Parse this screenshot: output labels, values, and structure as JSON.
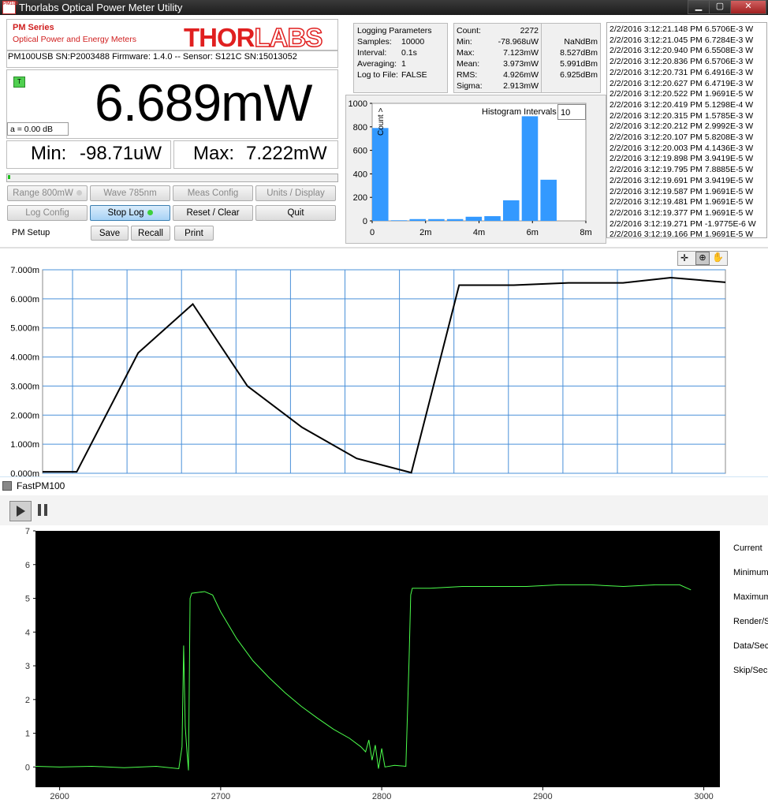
{
  "window": {
    "title": "Thorlabs Optical Power Meter Utility",
    "icon_text": "PM100",
    "controls": [
      "minimize",
      "maximize",
      "close"
    ]
  },
  "brand": {
    "series": "PM Series",
    "subtitle": "Optical Power and Energy Meters",
    "logo": "THORLABS"
  },
  "device": {
    "info": "PM100USB  SN:P2003488  Firmware: 1.4.0 -- Sensor: S121C  SN:15013052"
  },
  "reading": {
    "value": "6.689mW",
    "trigger_badge": "T",
    "attenuation": "a = 0.00  dB"
  },
  "minmax": {
    "min_label": "Min:",
    "min_value": "-98.71uW",
    "max_label": "Max:",
    "max_value": "7.222mW"
  },
  "buttons": {
    "range": "Range 800mW",
    "wave": "Wave 785nm",
    "meas_config": "Meas Config",
    "units_display": "Units / Display",
    "log_config": "Log Config",
    "stop_log": "Stop Log",
    "reset_clear": "Reset / Clear",
    "quit": "Quit",
    "pm_setup_label": "PM Setup",
    "save": "Save",
    "recall": "Recall",
    "print": "Print"
  },
  "logging": {
    "title": "Logging Parameters",
    "samples_label": "Samples:",
    "samples": "10000",
    "interval_label": "Interval:",
    "interval": "0.1s",
    "averaging_label": "Averaging:",
    "averaging": "1",
    "log_file_label": "Log to File:",
    "log_file": "FALSE"
  },
  "stats": {
    "count_label": "Count:",
    "count": "2272",
    "min_label": "Min:",
    "min": "-78.968uW",
    "min_dbm": "NaNdBm",
    "max_label": "Max:",
    "max": "7.123mW",
    "max_dbm": "8.527dBm",
    "mean_label": "Mean:",
    "mean": "3.973mW",
    "mean_dbm": "5.991dBm",
    "rms_label": "RMS:",
    "rms": "4.926mW",
    "rms_dbm": "6.925dBm",
    "sigma_label": "Sigma:",
    "sigma": "2.913mW"
  },
  "histogram": {
    "intervals_label": "Histogram Intervals",
    "intervals": "10",
    "count_axis_label": "Count >"
  },
  "log_lines": [
    "2/2/2016 3:12:21.148 PM 6.5706E-3 W",
    "2/2/2016 3:12:21.045 PM 6.7284E-3 W",
    "2/2/2016 3:12:20.940 PM 6.5508E-3 W",
    "2/2/2016 3:12:20.836 PM 6.5706E-3 W",
    "2/2/2016 3:12:20.731 PM 6.4916E-3 W",
    "2/2/2016 3:12:20.627 PM 6.4719E-3 W",
    "2/2/2016 3:12:20.522 PM 1.9691E-5 W",
    "2/2/2016 3:12:20.419 PM 5.1298E-4 W",
    "2/2/2016 3:12:20.315 PM 1.5785E-3 W",
    "2/2/2016 3:12:20.212 PM 2.9992E-3 W",
    "2/2/2016 3:12:20.107 PM 5.8208E-3 W",
    "2/2/2016 3:12:20.003 PM 4.1436E-3 W",
    "2/2/2016 3:12:19.898 PM 3.9419E-5 W",
    "2/2/2016 3:12:19.795 PM 7.8885E-5 W",
    "2/2/2016 3:12:19.691 PM 3.9419E-5 W",
    "2/2/2016 3:12:19.587 PM 1.9691E-5 W",
    "2/2/2016 3:12:19.481 PM 1.9691E-5 W",
    "2/2/2016 3:12:19.377 PM 1.9691E-5 W",
    "2/2/2016 3:12:19.271 PM -1.9775E-6 W",
    "2/2/2016 3:12:19.166 PM 1.9691E-5 W"
  ],
  "fast_window": {
    "title": "FastPM100",
    "side_labels": [
      "Current",
      "Minimum",
      "Maximum",
      "Render/S",
      "Data/Sec",
      "Skip/Sec"
    ]
  },
  "chart_data": [
    {
      "type": "bar",
      "name": "histogram",
      "x_ticks": [
        "0",
        "2m",
        "4m",
        "6m",
        "8m"
      ],
      "xlim": [
        0,
        0.008
      ],
      "y_ticks": [
        "0",
        "200",
        "400",
        "600",
        "800",
        "1000"
      ],
      "ylim": [
        0,
        1000
      ],
      "bin_centers": [
        0.0,
        0.0007,
        0.0014,
        0.0021,
        0.0028,
        0.0035,
        0.0042,
        0.0049,
        0.0056,
        0.0063,
        0.007
      ],
      "values": [
        790,
        5,
        15,
        15,
        15,
        35,
        40,
        175,
        890,
        350,
        0
      ],
      "color": "#3399ff"
    },
    {
      "type": "line",
      "name": "power-trend",
      "y_ticks": [
        "0.000m",
        "1.000m",
        "2.000m",
        "3.000m",
        "4.000m",
        "5.000m",
        "6.000m",
        "7.000m"
      ],
      "ylim": [
        0,
        7
      ],
      "x": [
        0.0,
        0.05,
        0.14,
        0.22,
        0.3,
        0.38,
        0.46,
        0.54,
        0.61,
        0.69,
        0.77,
        0.85,
        0.92,
        1.0
      ],
      "values": [
        0.05,
        0.05,
        4.14,
        5.82,
        3.0,
        1.58,
        0.51,
        0.02,
        6.47,
        6.47,
        6.55,
        6.55,
        6.73,
        6.57
      ],
      "line_color": "#000000",
      "grid_color": "#4a90d9"
    },
    {
      "type": "line",
      "name": "fast-trace",
      "x_ticks": [
        "2600",
        "2700",
        "2800",
        "2900",
        "3000"
      ],
      "xlim": [
        2585,
        3010
      ],
      "y_ticks": [
        "0",
        "1",
        "2",
        "3",
        "4",
        "5",
        "6",
        "7"
      ],
      "ylim": [
        -0.6,
        7
      ],
      "line_color": "#4cff4c",
      "background": "#000000",
      "points": [
        [
          2585,
          0.02
        ],
        [
          2600,
          0.0
        ],
        [
          2620,
          0.02
        ],
        [
          2640,
          -0.02
        ],
        [
          2660,
          0.02
        ],
        [
          2674,
          -0.05
        ],
        [
          2676,
          0.6
        ],
        [
          2677,
          3.6
        ],
        [
          2678,
          1.2
        ],
        [
          2679,
          0.5
        ],
        [
          2680,
          -0.1
        ],
        [
          2681,
          5.0
        ],
        [
          2682,
          5.15
        ],
        [
          2690,
          5.2
        ],
        [
          2695,
          5.1
        ],
        [
          2700,
          4.6
        ],
        [
          2710,
          3.8
        ],
        [
          2720,
          3.15
        ],
        [
          2730,
          2.65
        ],
        [
          2740,
          2.2
        ],
        [
          2750,
          1.8
        ],
        [
          2760,
          1.45
        ],
        [
          2770,
          1.12
        ],
        [
          2780,
          0.85
        ],
        [
          2787,
          0.6
        ],
        [
          2790,
          0.45
        ],
        [
          2792,
          0.8
        ],
        [
          2794,
          0.2
        ],
        [
          2796,
          0.65
        ],
        [
          2798,
          -0.05
        ],
        [
          2800,
          0.55
        ],
        [
          2802,
          0.0
        ],
        [
          2808,
          0.05
        ],
        [
          2815,
          0.02
        ],
        [
          2817,
          3.2
        ],
        [
          2818,
          5.1
        ],
        [
          2819,
          5.3
        ],
        [
          2830,
          5.3
        ],
        [
          2850,
          5.35
        ],
        [
          2870,
          5.35
        ],
        [
          2890,
          5.35
        ],
        [
          2910,
          5.4
        ],
        [
          2930,
          5.4
        ],
        [
          2950,
          5.35
        ],
        [
          2970,
          5.4
        ],
        [
          2985,
          5.4
        ],
        [
          2992,
          5.25
        ]
      ]
    }
  ]
}
